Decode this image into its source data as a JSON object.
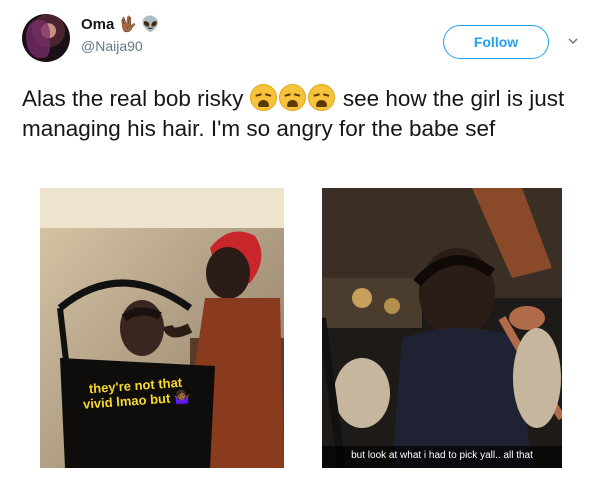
{
  "user": {
    "display_name": "Oma",
    "name_emojis": [
      "🖖🏾",
      "👽"
    ],
    "handle": "@Naija90"
  },
  "actions": {
    "follow_label": "Follow"
  },
  "tweet": {
    "text_before": "Alas the real bob risky ",
    "text_after": " see how the girl is just managing his hair. I'm so angry for the babe sef",
    "emoji_count": 3
  },
  "media": {
    "left_caption": "they're not that vivid lmao but 🤷🏾‍♀️",
    "right_caption": "but look at what i had to pick yall.. all that"
  },
  "colors": {
    "accent": "#1da1f2",
    "text": "#14171a",
    "muted": "#657786",
    "caption_yellow": "#f6d82c"
  }
}
